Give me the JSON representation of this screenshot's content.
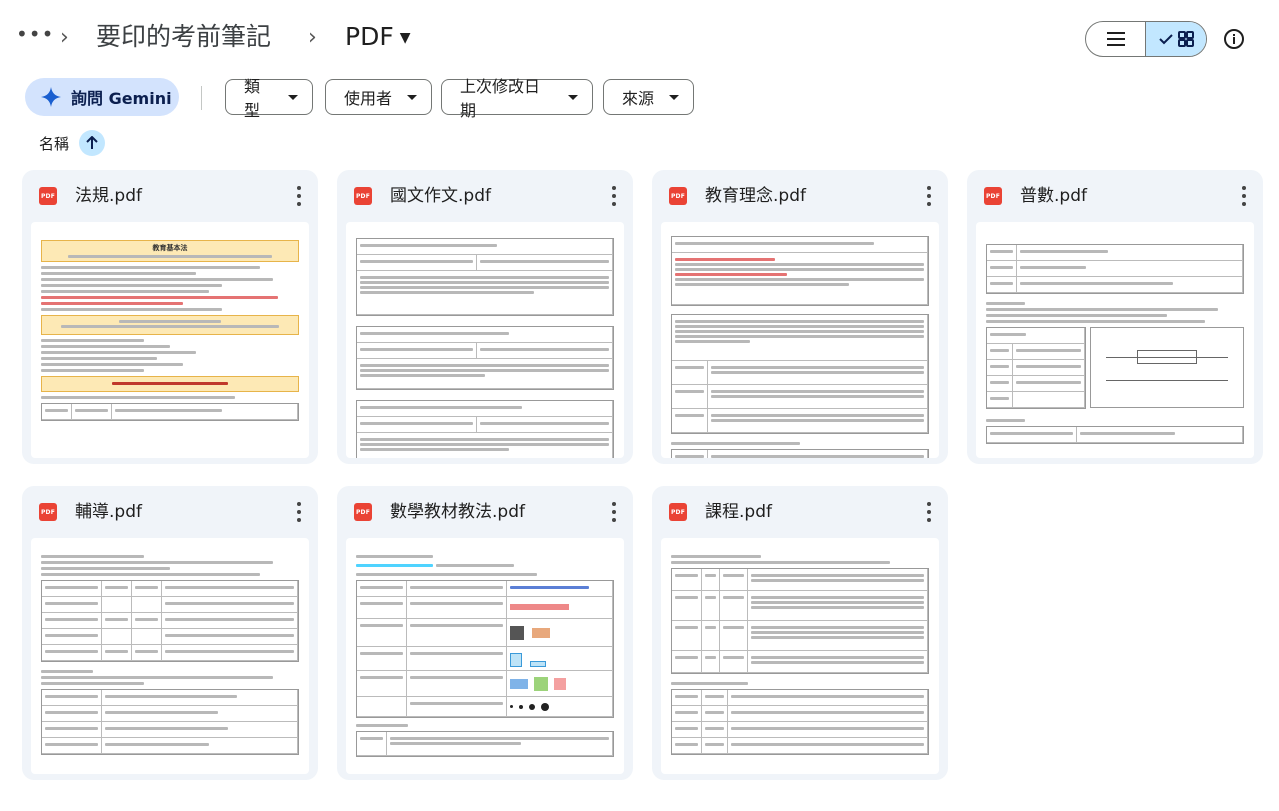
{
  "breadcrumb": {
    "parent": "要印的考前筆記",
    "current": "PDF"
  },
  "filters": {
    "gemini_label": "詢問 Gemini",
    "chips": [
      "類型",
      "使用者",
      "上次修改日期",
      "來源"
    ]
  },
  "sort": {
    "label": "名稱"
  },
  "files": [
    {
      "name": "法規.pdf",
      "type_label": "PDF",
      "preview_title": "教育基本法"
    },
    {
      "name": "國文作文.pdf",
      "type_label": "PDF"
    },
    {
      "name": "教育理念.pdf",
      "type_label": "PDF"
    },
    {
      "name": "普數.pdf",
      "type_label": "PDF"
    },
    {
      "name": "輔導.pdf",
      "type_label": "PDF"
    },
    {
      "name": "數學教材教法.pdf",
      "type_label": "PDF"
    },
    {
      "name": "課程.pdf",
      "type_label": "PDF"
    }
  ],
  "colors": {
    "accent": "#c2e7ff",
    "gemini_bg": "#d3e3fd",
    "card_bg": "#f0f4f9",
    "pdf_red": "#ea4335"
  },
  "icons": {
    "more": "more-horizontal-icon",
    "view_list": "list-icon",
    "view_grid": "grid-icon",
    "info": "info-icon",
    "sort": "arrow-up-icon",
    "gemini": "sparkle-icon"
  }
}
